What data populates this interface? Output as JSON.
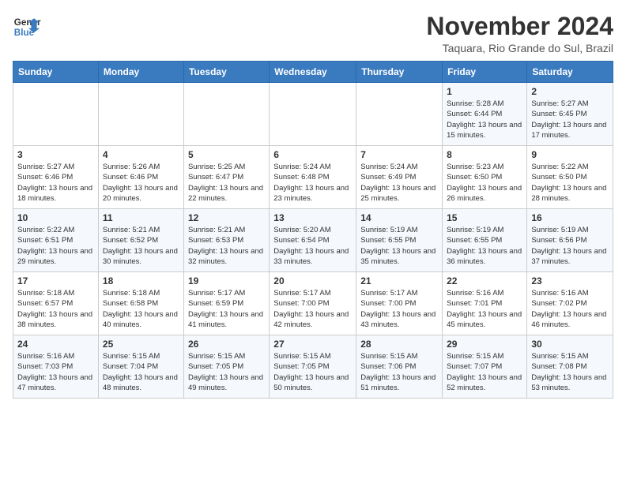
{
  "logo": {
    "line1": "General",
    "line2": "Blue"
  },
  "title": "November 2024",
  "location": "Taquara, Rio Grande do Sul, Brazil",
  "days_header": [
    "Sunday",
    "Monday",
    "Tuesday",
    "Wednesday",
    "Thursday",
    "Friday",
    "Saturday"
  ],
  "weeks": [
    [
      {
        "day": "",
        "info": ""
      },
      {
        "day": "",
        "info": ""
      },
      {
        "day": "",
        "info": ""
      },
      {
        "day": "",
        "info": ""
      },
      {
        "day": "",
        "info": ""
      },
      {
        "day": "1",
        "info": "Sunrise: 5:28 AM\nSunset: 6:44 PM\nDaylight: 13 hours and 15 minutes."
      },
      {
        "day": "2",
        "info": "Sunrise: 5:27 AM\nSunset: 6:45 PM\nDaylight: 13 hours and 17 minutes."
      }
    ],
    [
      {
        "day": "3",
        "info": "Sunrise: 5:27 AM\nSunset: 6:46 PM\nDaylight: 13 hours and 18 minutes."
      },
      {
        "day": "4",
        "info": "Sunrise: 5:26 AM\nSunset: 6:46 PM\nDaylight: 13 hours and 20 minutes."
      },
      {
        "day": "5",
        "info": "Sunrise: 5:25 AM\nSunset: 6:47 PM\nDaylight: 13 hours and 22 minutes."
      },
      {
        "day": "6",
        "info": "Sunrise: 5:24 AM\nSunset: 6:48 PM\nDaylight: 13 hours and 23 minutes."
      },
      {
        "day": "7",
        "info": "Sunrise: 5:24 AM\nSunset: 6:49 PM\nDaylight: 13 hours and 25 minutes."
      },
      {
        "day": "8",
        "info": "Sunrise: 5:23 AM\nSunset: 6:50 PM\nDaylight: 13 hours and 26 minutes."
      },
      {
        "day": "9",
        "info": "Sunrise: 5:22 AM\nSunset: 6:50 PM\nDaylight: 13 hours and 28 minutes."
      }
    ],
    [
      {
        "day": "10",
        "info": "Sunrise: 5:22 AM\nSunset: 6:51 PM\nDaylight: 13 hours and 29 minutes."
      },
      {
        "day": "11",
        "info": "Sunrise: 5:21 AM\nSunset: 6:52 PM\nDaylight: 13 hours and 30 minutes."
      },
      {
        "day": "12",
        "info": "Sunrise: 5:21 AM\nSunset: 6:53 PM\nDaylight: 13 hours and 32 minutes."
      },
      {
        "day": "13",
        "info": "Sunrise: 5:20 AM\nSunset: 6:54 PM\nDaylight: 13 hours and 33 minutes."
      },
      {
        "day": "14",
        "info": "Sunrise: 5:19 AM\nSunset: 6:55 PM\nDaylight: 13 hours and 35 minutes."
      },
      {
        "day": "15",
        "info": "Sunrise: 5:19 AM\nSunset: 6:55 PM\nDaylight: 13 hours and 36 minutes."
      },
      {
        "day": "16",
        "info": "Sunrise: 5:19 AM\nSunset: 6:56 PM\nDaylight: 13 hours and 37 minutes."
      }
    ],
    [
      {
        "day": "17",
        "info": "Sunrise: 5:18 AM\nSunset: 6:57 PM\nDaylight: 13 hours and 38 minutes."
      },
      {
        "day": "18",
        "info": "Sunrise: 5:18 AM\nSunset: 6:58 PM\nDaylight: 13 hours and 40 minutes."
      },
      {
        "day": "19",
        "info": "Sunrise: 5:17 AM\nSunset: 6:59 PM\nDaylight: 13 hours and 41 minutes."
      },
      {
        "day": "20",
        "info": "Sunrise: 5:17 AM\nSunset: 7:00 PM\nDaylight: 13 hours and 42 minutes."
      },
      {
        "day": "21",
        "info": "Sunrise: 5:17 AM\nSunset: 7:00 PM\nDaylight: 13 hours and 43 minutes."
      },
      {
        "day": "22",
        "info": "Sunrise: 5:16 AM\nSunset: 7:01 PM\nDaylight: 13 hours and 45 minutes."
      },
      {
        "day": "23",
        "info": "Sunrise: 5:16 AM\nSunset: 7:02 PM\nDaylight: 13 hours and 46 minutes."
      }
    ],
    [
      {
        "day": "24",
        "info": "Sunrise: 5:16 AM\nSunset: 7:03 PM\nDaylight: 13 hours and 47 minutes."
      },
      {
        "day": "25",
        "info": "Sunrise: 5:15 AM\nSunset: 7:04 PM\nDaylight: 13 hours and 48 minutes."
      },
      {
        "day": "26",
        "info": "Sunrise: 5:15 AM\nSunset: 7:05 PM\nDaylight: 13 hours and 49 minutes."
      },
      {
        "day": "27",
        "info": "Sunrise: 5:15 AM\nSunset: 7:05 PM\nDaylight: 13 hours and 50 minutes."
      },
      {
        "day": "28",
        "info": "Sunrise: 5:15 AM\nSunset: 7:06 PM\nDaylight: 13 hours and 51 minutes."
      },
      {
        "day": "29",
        "info": "Sunrise: 5:15 AM\nSunset: 7:07 PM\nDaylight: 13 hours and 52 minutes."
      },
      {
        "day": "30",
        "info": "Sunrise: 5:15 AM\nSunset: 7:08 PM\nDaylight: 13 hours and 53 minutes."
      }
    ]
  ]
}
